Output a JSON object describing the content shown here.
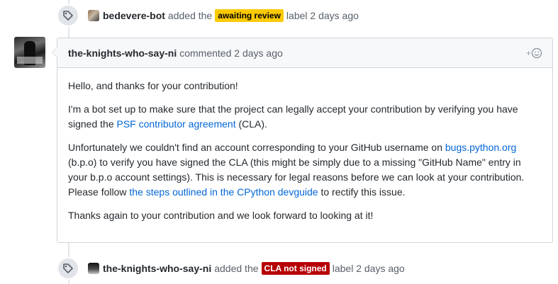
{
  "events": {
    "top": {
      "icon": "tag-icon",
      "author": "bedevere-bot",
      "action": "added the",
      "label": "awaiting review",
      "label_color": "#fbca04",
      "suffix": "label 2 days ago"
    },
    "bottom": {
      "icon": "tag-icon",
      "author": "the-knights-who-say-ni",
      "action": "added the",
      "label": "CLA not signed",
      "label_color": "#b60205",
      "suffix": "label 2 days ago"
    }
  },
  "comment": {
    "author": "the-knights-who-say-ni",
    "meta": "commented 2 days ago",
    "reaction_icon": "add-reaction-icon",
    "body": {
      "p1": "Hello, and thanks for your contribution!",
      "p2_before": "I'm a bot set up to make sure that the project can legally accept your contribution by verifying you have signed the ",
      "p2_link": "PSF contributor agreement",
      "p2_after": " (CLA).",
      "p3_before": "Unfortunately we couldn't find an account corresponding to your GitHub username on ",
      "p3_link1": "bugs.python.org",
      "p3_middle": " (b.p.o) to verify you have signed the CLA (this might be simply due to a missing \"GitHub Name\" entry in your b.p.o account settings). This is necessary for legal reasons before we can look at your contribution. Please follow ",
      "p3_link2": "the steps outlined in the CPython devguide",
      "p3_after": " to rectify this issue.",
      "p4": "Thanks again to your contribution and we look forward to looking at it!"
    }
  },
  "colors": {
    "link": "#0366d6",
    "header_bg": "#f6f8fa",
    "border": "#d1d5da"
  }
}
